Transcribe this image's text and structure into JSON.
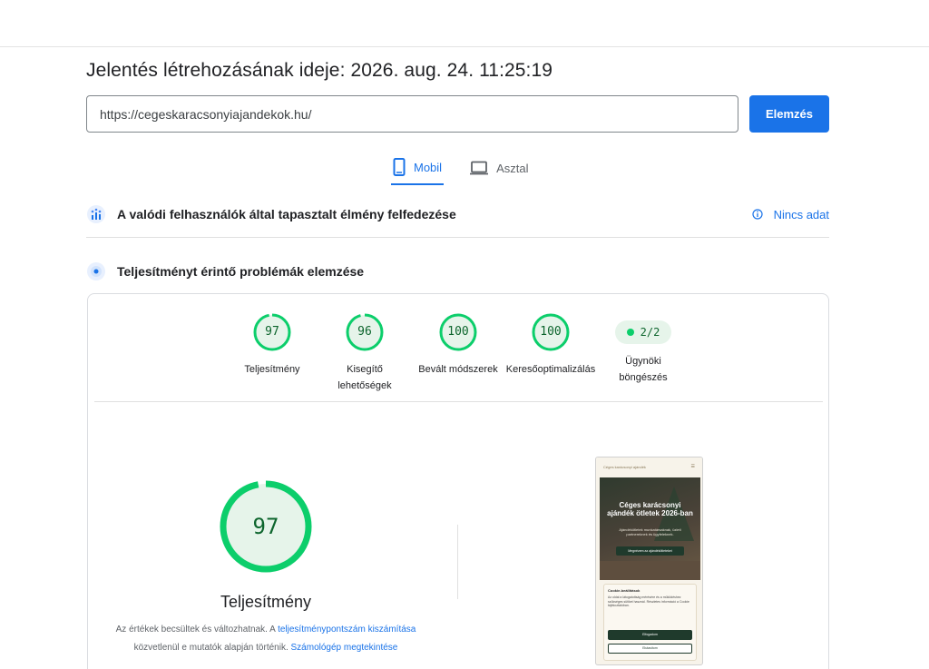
{
  "header": {
    "report_time": "Jelentés létrehozásának ideje: 2026. aug. 24. 11:25:19"
  },
  "search": {
    "url_value": "https://cegeskaracsonyiajandekok.hu/",
    "analyze_label": "Elemzés"
  },
  "device_tabs": [
    {
      "label": "Mobil",
      "icon": "smartphone-icon",
      "active": true
    },
    {
      "label": "Asztal",
      "icon": "laptop-icon",
      "active": false
    }
  ],
  "field_data": {
    "title": "A valódi felhasználók által tapasztalt élmény felfedezése",
    "status": "Nincs adat"
  },
  "lab_data": {
    "title": "Teljesítményt érintő problémák elemzése"
  },
  "categories": [
    {
      "label": "Teljesítmény",
      "score": 97
    },
    {
      "label": "Kisegítő lehetőségek",
      "score": 96
    },
    {
      "label": "Bevált módszerek",
      "score": 100
    },
    {
      "label": "Keresőoptimalizálás",
      "score": 100
    },
    {
      "label": "Ügynöki böngészés",
      "score_text": "2/2"
    }
  ],
  "performance": {
    "score": 97,
    "title": "Teljesítmény",
    "note_prefix": "Az értékek becsültek és változhatnak. A",
    "note_link1": "teljesítménypontszám kiszámítása",
    "note_middle": "közvetlenül e mutatók alapján történik.",
    "note_link2": "Számológép megtekintése"
  },
  "screenshot": {
    "site_name": "Céges karácsonyi ajándék",
    "hero_title": "Céges karácsonyi ajándék ötletek 2026-ban",
    "hero_sub": "Ajándékötletek munkatársaknak, üzleti partnereknek és ügyfeleknek.",
    "hero_button": "Megnézem az ajándékötleteket",
    "cookie_title": "Cookie-beállítások",
    "cookie_text": "Az oldal a látogatottság mérésére és a működéshez szükséges sütiket használ. Részletes információ a Cookie tájékoztatóban.",
    "cookie_accept": "Elfogadom",
    "cookie_reject": "Elutasítom"
  },
  "colors": {
    "accent": "#1a73e8",
    "pass": "#0cce6b",
    "pass_text": "#0d652d",
    "pass_fill": "#e6f4ea"
  }
}
